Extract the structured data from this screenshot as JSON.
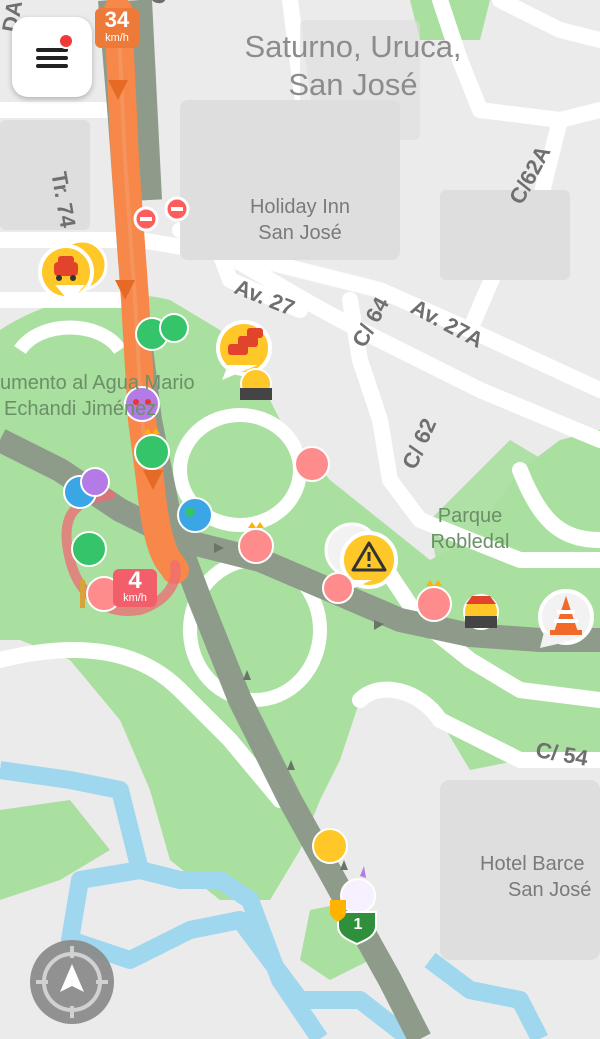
{
  "map": {
    "area_label_line1": "Saturno, Uruca,",
    "area_label_line2": "San José",
    "poi": {
      "holiday_inn_line1": "Holiday Inn",
      "holiday_inn_line2": "San José",
      "parque_line1": "Parque",
      "parque_line2": "Robledal",
      "monumento_line1": "umento al Agua Mario",
      "monumento_line2": "Echandi Jiménez",
      "hotel_line1": "Hotel Barce",
      "hotel_line2": "San José"
    },
    "streets": {
      "tr74": "Tr. 74",
      "av27": "Av. 27",
      "c64": "C/ 64",
      "av27a": "Av. 27A",
      "c62": "C/ 62",
      "c62a": "C/62A",
      "c54": "C/ 54",
      "edge_top": "C",
      "edge_left": "DA"
    }
  },
  "speed_badges": {
    "top_value": "34",
    "top_unit": "km/h",
    "bottom_value": "4",
    "bottom_unit": "km/h"
  },
  "route_shield": {
    "number": "1"
  },
  "alerts": [
    {
      "type": "traffic-jam",
      "icon": "car-icon"
    },
    {
      "type": "traffic-jam",
      "icon": "cars-icon"
    },
    {
      "type": "hazard",
      "icon": "warning-triangle-icon"
    },
    {
      "type": "construction",
      "icon": "traffic-cone-icon"
    }
  ],
  "colors": {
    "route": "#f7884a",
    "park": "#a5dd9b",
    "water": "#9fd7ef",
    "road": "#ffffff",
    "highway": "#8f9b8a",
    "alert_yellow": "#ffc727",
    "wazer_pink": "#ff8c8c",
    "wazer_green": "#35c46a"
  }
}
